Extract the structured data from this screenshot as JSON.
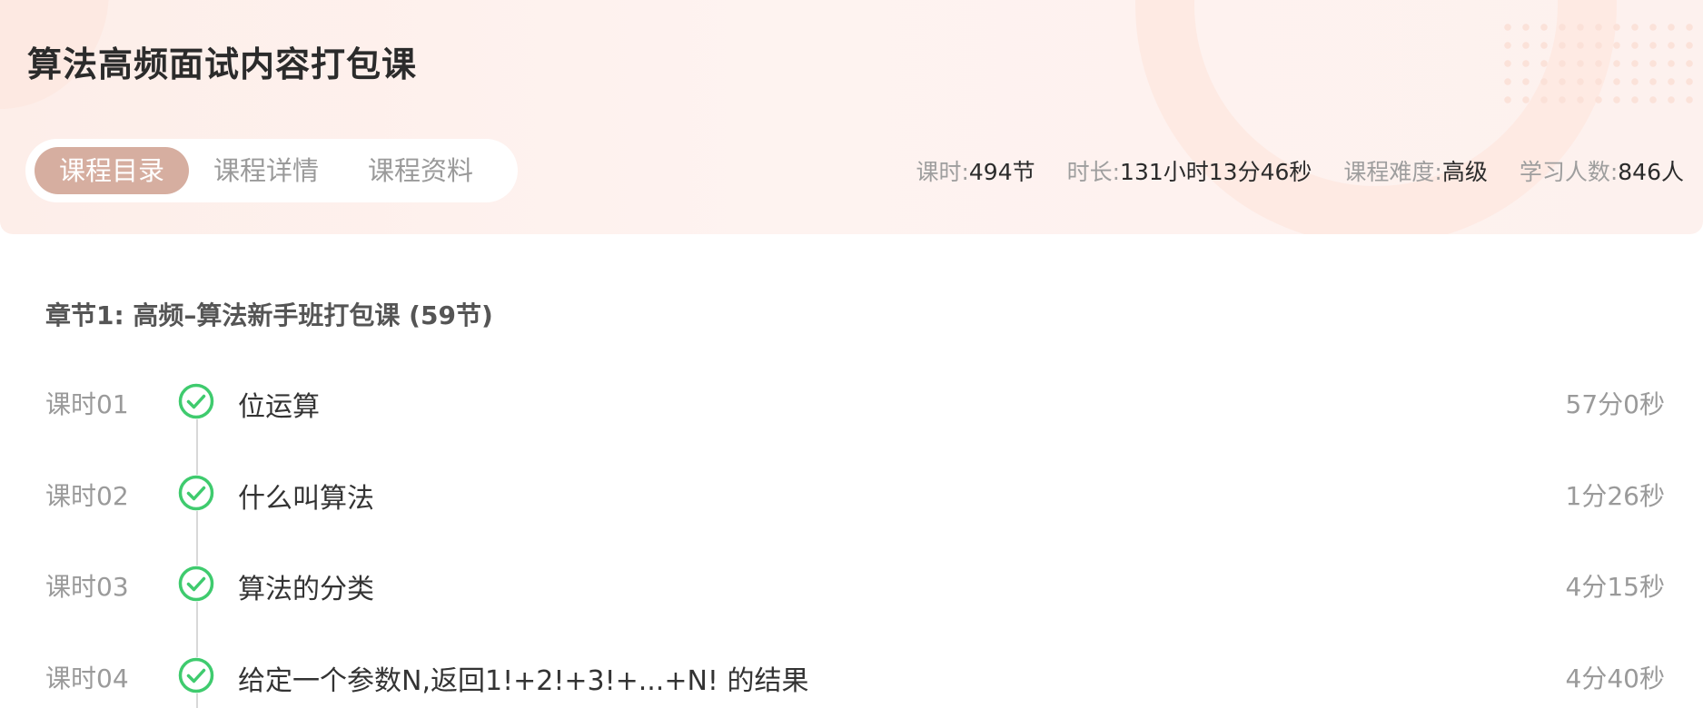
{
  "course": {
    "title": "算法高频面试内容打包课"
  },
  "tabs": [
    {
      "label": "课程目录",
      "active": true
    },
    {
      "label": "课程详情",
      "active": false
    },
    {
      "label": "课程资料",
      "active": false
    }
  ],
  "stats": {
    "lessons": {
      "label": "课时:",
      "value": "494节"
    },
    "duration": {
      "label": "时长:",
      "value": "131小时13分46秒"
    },
    "difficulty": {
      "label": "课程难度:",
      "value": "高级"
    },
    "learners": {
      "label": "学习人数:",
      "value": "846人"
    }
  },
  "chapter": {
    "title": "章节1: 高频–算法新手班打包课 (59节)"
  },
  "lessons": [
    {
      "index": "课时01",
      "title": "位运算",
      "duration": "57分0秒",
      "completed": true
    },
    {
      "index": "课时02",
      "title": "什么叫算法",
      "duration": "1分26秒",
      "completed": true
    },
    {
      "index": "课时03",
      "title": "算法的分类",
      "duration": "4分15秒",
      "completed": true
    },
    {
      "index": "课时04",
      "title": "给定一个参数N,返回1!+2!+3!+...+N! 的结果",
      "duration": "4分40秒",
      "completed": true
    }
  ],
  "colors": {
    "accent": "#d6aea0",
    "check": "#3fcb6e",
    "header_bg": "#fdeee9"
  },
  "icons": {
    "lesson_status": "check-circle-icon"
  }
}
